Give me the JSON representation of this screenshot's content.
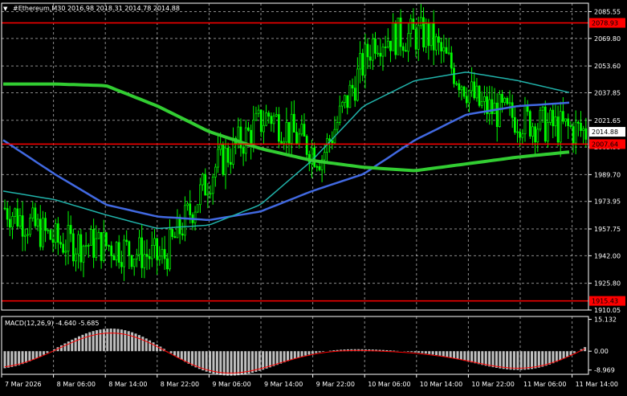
{
  "header": {
    "symbol_timeframe": "#Ethereum,M30",
    "ohlc": "2016.98 2018.31 2014.78 2014.88",
    "menu_glyph": "▼"
  },
  "price_axis": {
    "ticks": [
      "2085.55",
      "2069.80",
      "2053.60",
      "2037.85",
      "2021.65",
      "2005.90",
      "1989.70",
      "1973.95",
      "1957.75",
      "1942.00",
      "1925.80",
      "1910.05"
    ],
    "range": [
      1910.05,
      2090.5
    ]
  },
  "levels": [
    {
      "price": 2078.93,
      "label": "2078.93"
    },
    {
      "price": 2007.64,
      "label": "2007.64"
    },
    {
      "price": 1915.43,
      "label": "1915.43"
    }
  ],
  "current_price": {
    "value": 2014.88,
    "label": "2014.88"
  },
  "macd": {
    "label": "MACD(12,26,9) -4.640 -5.685",
    "ticks": [
      "15.132",
      "0.00",
      "-8.969"
    ],
    "range": [
      -11,
      16.5
    ]
  },
  "time_axis": {
    "labels": [
      "7 Mar 2026",
      "8 Mar 06:00",
      "8 Mar 14:00",
      "8 Mar 22:00",
      "9 Mar 06:00",
      "9 Mar 14:00",
      "9 Mar 22:00",
      "10 Mar 06:00",
      "10 Mar 14:00",
      "10 Mar 22:00",
      "11 Mar 06:00",
      "11 Mar 14:00"
    ]
  },
  "colors": {
    "background": "#000000",
    "candle": "#00ff00",
    "grid": "#ffffff",
    "level_line": "#ff0000",
    "level_label_bg": "#ff0000",
    "price_label_bg": "#ffffff",
    "ma_fast": "#4169e1",
    "ma_mid": "#20b2aa",
    "ma_slow": "#32cd32",
    "macd_hist": "#c0c0c0",
    "macd_signal": "#ff0000"
  },
  "chart_data": {
    "type": "line",
    "title": "",
    "xlabel": "",
    "ylabel": "",
    "ylim": [
      1910.05,
      2090.5
    ],
    "x": [
      "7 Mar 2026",
      "8 Mar 06:00",
      "8 Mar 14:00",
      "8 Mar 22:00",
      "9 Mar 06:00",
      "9 Mar 14:00",
      "9 Mar 22:00",
      "10 Mar 06:00",
      "10 Mar 14:00",
      "10 Mar 22:00",
      "11 Mar 06:00",
      "11 Mar 14:00"
    ],
    "series": [
      {
        "name": "",
        "values": [
          1970,
          1950,
          1948,
          1940,
          1995,
          2025,
          2000,
          2070,
          2072,
          2030,
          2020,
          2015
        ]
      },
      {
        "name": "",
        "values": [
          2010,
          1990,
          1972,
          1965,
          1963,
          1968,
          1980,
          1990,
          2010,
          2025,
          2030,
          2032
        ]
      },
      {
        "name": "",
        "values": [
          1980,
          1975,
          1966,
          1958,
          1960,
          1972,
          1998,
          2030,
          2045,
          2050,
          2045,
          2038
        ]
      },
      {
        "name": "",
        "values": [
          2043,
          2043,
          2042,
          2030,
          2015,
          2005,
          1998,
          1994,
          1992,
          1996,
          2000,
          2003
        ]
      }
    ]
  }
}
